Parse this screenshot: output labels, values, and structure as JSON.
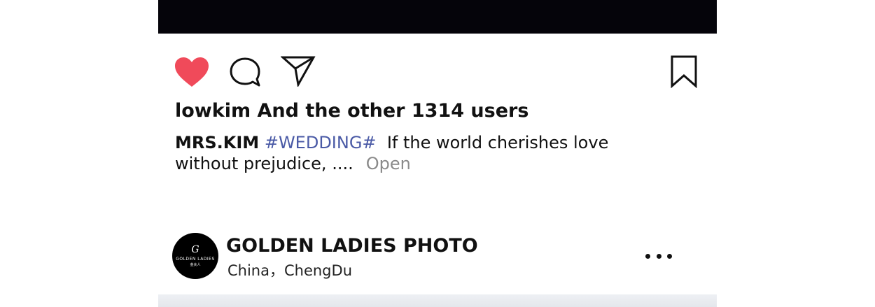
{
  "post": {
    "likes_text": "lowkim And the other 1314 users",
    "caption": {
      "author": "MRS.KIM",
      "hashtag": "#WEDDING#",
      "text": "If the world cherishes love without prejudice, ....",
      "open_label": "Open"
    },
    "icons": {
      "like": "heart-icon",
      "comment": "comment-icon",
      "share": "send-icon",
      "save": "bookmark-icon"
    },
    "like_color": "#f04a5a"
  },
  "next_post": {
    "account_name": "GOLDEN LADIES PHOTO",
    "location": "China，ChengDu",
    "avatar": {
      "monogram": "G",
      "brand_text": "GOLDEN LADIES",
      "sub_text": "金夫人"
    },
    "more_icon": "more-horizontal-icon"
  }
}
